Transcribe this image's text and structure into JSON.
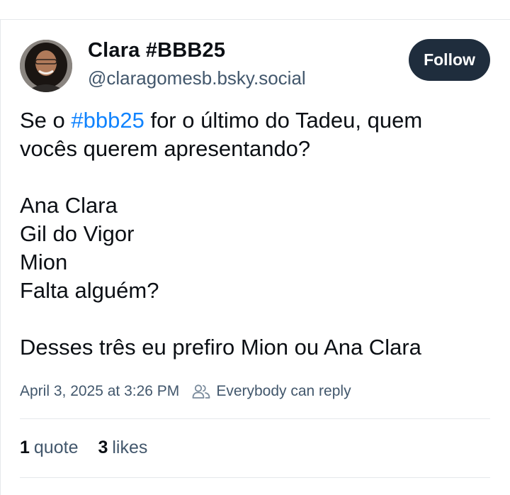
{
  "author": {
    "display_name": "Clara #BBB25",
    "handle": "@claragomesb.bsky.social",
    "avatar_icon": "profile-photo"
  },
  "follow_label": "Follow",
  "post": {
    "line1_prefix": "Se o ",
    "line1_hashtag": "#bbb25",
    "line1_suffix": " for o último do Tadeu, quem",
    "line2": "vocês querem apresentando?",
    "line3": "Ana Clara",
    "line4": "Gil do Vigor",
    "line5": "Mion",
    "line6": "Falta alguém?",
    "line7": "Desses três eu prefiro Mion ou Ana Clara"
  },
  "meta": {
    "timestamp": "April 3, 2025 at 3:26 PM",
    "reply_setting": "Everybody can reply",
    "reply_icon": "people-icon"
  },
  "stats": {
    "quotes_count": "1",
    "quotes_label": "quote",
    "likes_count": "3",
    "likes_label": "likes"
  },
  "colors": {
    "link": "#1083fe",
    "follow_bg": "#1f2d3d",
    "muted_text": "#42576c",
    "text": "#0b0f14",
    "divider": "#e5e8eb"
  }
}
